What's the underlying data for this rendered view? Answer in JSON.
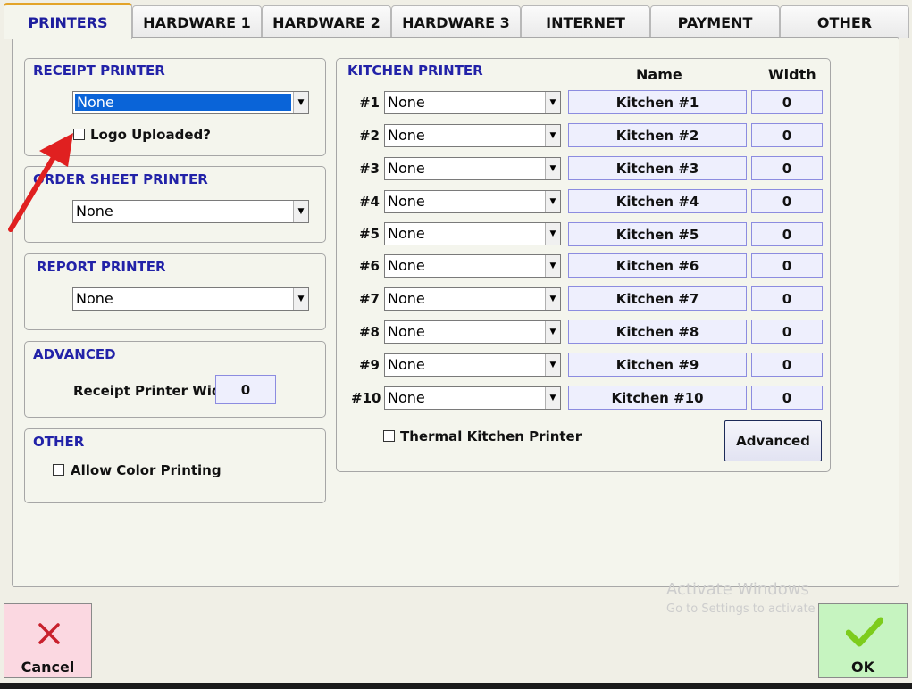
{
  "tabs": [
    {
      "label": "PRINTERS",
      "active": true
    },
    {
      "label": "HARDWARE 1"
    },
    {
      "label": "HARDWARE 2"
    },
    {
      "label": "HARDWARE 3"
    },
    {
      "label": "INTERNET"
    },
    {
      "label": "PAYMENT"
    },
    {
      "label": "OTHER"
    }
  ],
  "receipt_printer": {
    "title": "RECEIPT PRINTER",
    "value": "None",
    "logo_label": "Logo Uploaded?"
  },
  "order_sheet_printer": {
    "title": "ORDER SHEET PRINTER",
    "value": "None"
  },
  "report_printer": {
    "title": "REPORT PRINTER",
    "value": "None"
  },
  "advanced": {
    "title": "ADVANCED",
    "width_label": "Receipt Printer Width",
    "width_value": "0"
  },
  "other": {
    "title": "OTHER",
    "color_label": "Allow Color Printing"
  },
  "kitchen": {
    "title": "KITCHEN PRINTER",
    "name_header": "Name",
    "width_header": "Width",
    "rows": [
      {
        "num": "#1",
        "value": "None",
        "name": "Kitchen #1",
        "width": "0"
      },
      {
        "num": "#2",
        "value": "None",
        "name": "Kitchen #2",
        "width": "0"
      },
      {
        "num": "#3",
        "value": "None",
        "name": "Kitchen #3",
        "width": "0"
      },
      {
        "num": "#4",
        "value": "None",
        "name": "Kitchen #4",
        "width": "0"
      },
      {
        "num": "#5",
        "value": "None",
        "name": "Kitchen #5",
        "width": "0"
      },
      {
        "num": "#6",
        "value": "None",
        "name": "Kitchen #6",
        "width": "0"
      },
      {
        "num": "#7",
        "value": "None",
        "name": "Kitchen #7",
        "width": "0"
      },
      {
        "num": "#8",
        "value": "None",
        "name": "Kitchen #8",
        "width": "0"
      },
      {
        "num": "#9",
        "value": "None",
        "name": "Kitchen #9",
        "width": "0"
      },
      {
        "num": "#10",
        "value": "None",
        "name": "Kitchen #10",
        "width": "0"
      }
    ],
    "thermal_label": "Thermal Kitchen Printer",
    "advanced_button": "Advanced"
  },
  "buttons": {
    "cancel": "Cancel",
    "ok": "OK"
  },
  "watermark": {
    "line1": "Activate Windows",
    "line2": "Go to Settings to activate Windows."
  },
  "colors": {
    "title_blue": "#2222a8",
    "active_tab_accent": "#e3a42a",
    "arrow_red": "#e02020",
    "ok_check": "#7dcc1c"
  }
}
